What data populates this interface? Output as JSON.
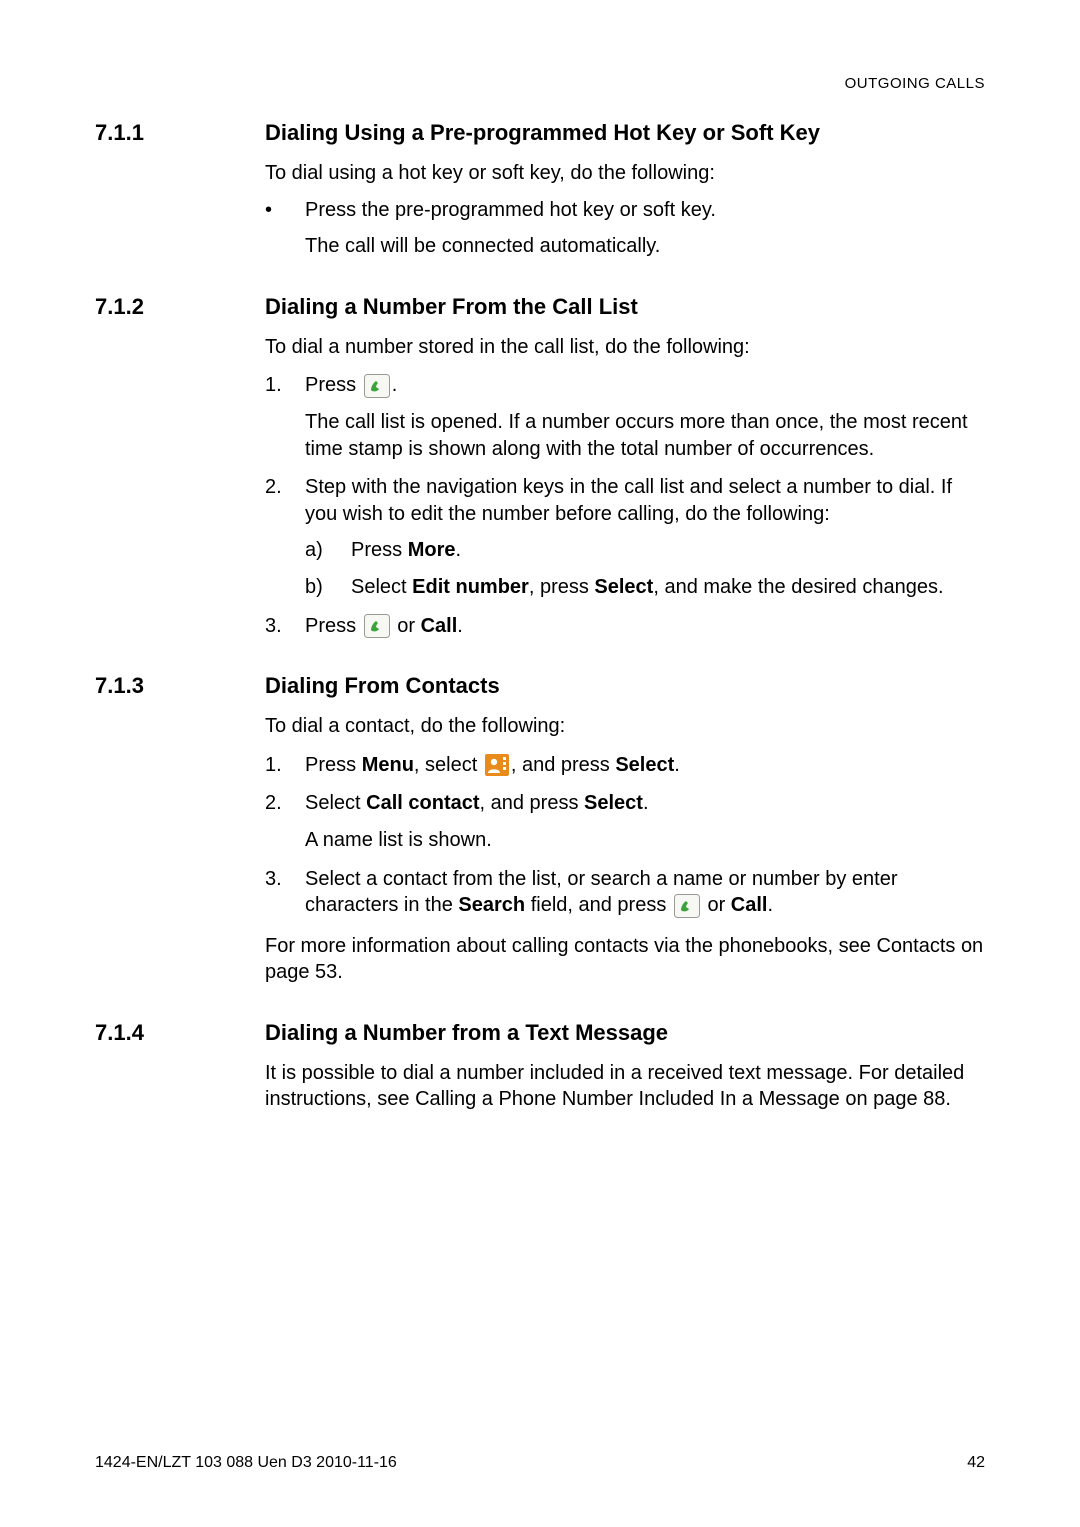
{
  "running_header": "OUTGOING CALLS",
  "sections": {
    "s1": {
      "num": "7.1.1",
      "title": "Dialing Using a Pre-programmed Hot Key or Soft Key"
    },
    "s2": {
      "num": "7.1.2",
      "title": "Dialing a Number From the Call List"
    },
    "s3": {
      "num": "7.1.3",
      "title": "Dialing From Contacts"
    },
    "s4": {
      "num": "7.1.4",
      "title": "Dialing a Number from a Text Message"
    }
  },
  "s1": {
    "intro": "To dial using a hot key or soft key, do the following:",
    "bullet1": "Press the pre-programmed hot key or soft key.",
    "bullet1_sub": "The call will be connected automatically."
  },
  "s2": {
    "intro": "To dial a number stored in the call list, do the following:",
    "n1": "1.",
    "n1_a": "Press ",
    "n1_b": ".",
    "n1_sub": "The call list is opened. If a number occurs more than once, the most recent time stamp is shown along with the total number of occurrences.",
    "n2": "2.",
    "n2_text": "Step with the navigation keys in the call list and select a number to dial. If you wish to edit the number before calling, do the following:",
    "a_mark": "a)",
    "a_a": "Press ",
    "a_b": "More",
    "a_c": ".",
    "b_mark": "b)",
    "b_a": "Select ",
    "b_b": "Edit number",
    "b_c": ", press ",
    "b_d": "Select",
    "b_e": ", and make the desired changes.",
    "n3": "3.",
    "n3_a": "Press ",
    "n3_b": " or ",
    "n3_c": "Call",
    "n3_d": "."
  },
  "s3": {
    "intro": "To dial a contact, do the following:",
    "n1": "1.",
    "n1_a": "Press ",
    "n1_b": "Menu",
    "n1_c": ", select ",
    "n1_d": ", and press ",
    "n1_e": "Select",
    "n1_f": ".",
    "n2": "2.",
    "n2_a": "Select ",
    "n2_b": "Call contact",
    "n2_c": ", and press ",
    "n2_d": "Select",
    "n2_e": ".",
    "n2_sub": "A name list is shown.",
    "n3": "3.",
    "n3_a": "Select a contact from the list, or search a name or number by enter characters in the ",
    "n3_b": "Search",
    "n3_c": " field, and press ",
    "n3_d": " or ",
    "n3_e": "Call",
    "n3_f": ".",
    "tail": "For more information about calling contacts via the phonebooks, see Contacts on page 53."
  },
  "s4": {
    "para": "It is possible to dial a number included in a received text message. For detailed instructions, see Calling a Phone Number Included In a Message on page 88."
  },
  "footer": {
    "left": "1424-EN/LZT 103 088 Uen D3 2010-11-16",
    "right": "42"
  },
  "marks": {
    "bullet": "•"
  }
}
